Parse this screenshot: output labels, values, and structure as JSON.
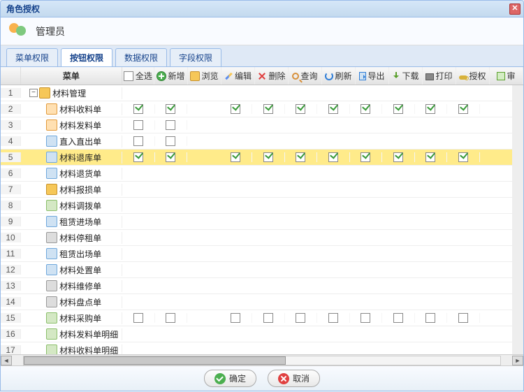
{
  "dialog_title": "角色授权",
  "role_name": "管理员",
  "tabs": [
    "菜单权限",
    "按钮权限",
    "数据权限",
    "字段权限"
  ],
  "active_tab_index": 1,
  "menu_header": "菜单",
  "select_all_label": "全选",
  "columns": [
    {
      "key": "add",
      "label": "新增",
      "icon": "add"
    },
    {
      "key": "browse",
      "label": "浏览",
      "icon": "folder"
    },
    {
      "key": "edit",
      "label": "编辑",
      "icon": "pencil"
    },
    {
      "key": "delete",
      "label": "删除",
      "icon": "del"
    },
    {
      "key": "query",
      "label": "查询",
      "icon": "search"
    },
    {
      "key": "refresh",
      "label": "刷新",
      "icon": "refresh"
    },
    {
      "key": "export",
      "label": "导出",
      "icon": "export"
    },
    {
      "key": "download",
      "label": "下载",
      "icon": "download"
    },
    {
      "key": "print",
      "label": "打印",
      "icon": "print"
    },
    {
      "key": "auth",
      "label": "授权",
      "icon": "key"
    },
    {
      "key": "approve",
      "label": "审",
      "icon": "approve"
    }
  ],
  "rows": [
    {
      "n": 1,
      "level": 0,
      "expand": true,
      "icon": "folder",
      "label": "材料管理",
      "checks": []
    },
    {
      "n": 2,
      "level": 1,
      "icon": "ni-house",
      "label": "材料收料单",
      "all": true,
      "checks": [
        true,
        null,
        true,
        true,
        true,
        true,
        true,
        true,
        true,
        true
      ]
    },
    {
      "n": 3,
      "level": 1,
      "icon": "ni-house",
      "label": "材料发料单",
      "all": false,
      "checks": [
        false,
        null,
        null,
        null,
        null,
        null,
        null,
        null,
        null,
        null
      ]
    },
    {
      "n": 4,
      "level": 1,
      "icon": "ni-blue",
      "label": "直入直出单",
      "all": false,
      "checks": [
        false,
        null,
        null,
        null,
        null,
        null,
        null,
        null,
        null,
        null
      ]
    },
    {
      "n": 5,
      "selected": true,
      "level": 1,
      "icon": "ni-blue",
      "label": "材料退库单",
      "all": true,
      "checks": [
        true,
        null,
        true,
        true,
        true,
        true,
        true,
        true,
        true,
        true
      ]
    },
    {
      "n": 6,
      "level": 1,
      "icon": "ni-blue",
      "label": "材料退货单",
      "checks": []
    },
    {
      "n": 7,
      "level": 1,
      "icon": "folder",
      "label": "材料报损单",
      "checks": []
    },
    {
      "n": 8,
      "level": 1,
      "icon": "ni-doc",
      "label": "材料调拨单",
      "checks": []
    },
    {
      "n": 9,
      "level": 1,
      "icon": "ni-blue",
      "label": "租赁进场单",
      "checks": []
    },
    {
      "n": 10,
      "level": 1,
      "icon": "ni-tool",
      "label": "材料停租单",
      "checks": []
    },
    {
      "n": 11,
      "level": 1,
      "icon": "ni-blue",
      "label": "租赁出场单",
      "checks": []
    },
    {
      "n": 12,
      "level": 1,
      "icon": "ni-blue",
      "label": "材料处置单",
      "checks": []
    },
    {
      "n": 13,
      "level": 1,
      "icon": "ni-tool",
      "label": "材料维修单",
      "checks": []
    },
    {
      "n": 14,
      "level": 1,
      "icon": "ni-tool",
      "label": "材料盘点单",
      "checks": []
    },
    {
      "n": 15,
      "level": 1,
      "icon": "ni-doc",
      "label": "材料采购单",
      "all": false,
      "checks": [
        false,
        null,
        false,
        false,
        false,
        false,
        false,
        false,
        false,
        false
      ]
    },
    {
      "n": 16,
      "level": 1,
      "icon": "ni-doc",
      "label": "材料发料单明细",
      "checks": []
    },
    {
      "n": 17,
      "level": 1,
      "icon": "ni-doc",
      "label": "材料收料单明细",
      "checks": []
    }
  ],
  "ok_label": "确定",
  "cancel_label": "取消"
}
